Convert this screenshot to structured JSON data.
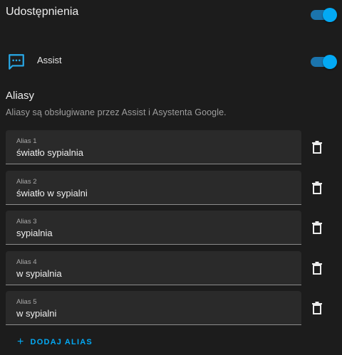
{
  "sharing": {
    "title": "Udostępnienia",
    "enabled": true
  },
  "assist": {
    "label": "Assist",
    "enabled": true,
    "icon": "message-processing-icon"
  },
  "aliases": {
    "title": "Aliasy",
    "description": "Aliasy są obsługiwane przez Assist i Asystenta Google.",
    "items": [
      {
        "label": "Alias 1",
        "value": "światło sypialnia"
      },
      {
        "label": "Alias 2",
        "value": "światło w sypialni"
      },
      {
        "label": "Alias 3",
        "value": "sypialnia"
      },
      {
        "label": "Alias 4",
        "value": "w sypialnia"
      },
      {
        "label": "Alias 5",
        "value": "w sypialni"
      }
    ],
    "add_label": "DODAJ ALIAS",
    "add_icon": "plus-icon",
    "delete_icon": "trash-icon"
  },
  "colors": {
    "accent": "#03a9f4",
    "background": "#1c1c1c",
    "field": "#2a2a2a"
  }
}
